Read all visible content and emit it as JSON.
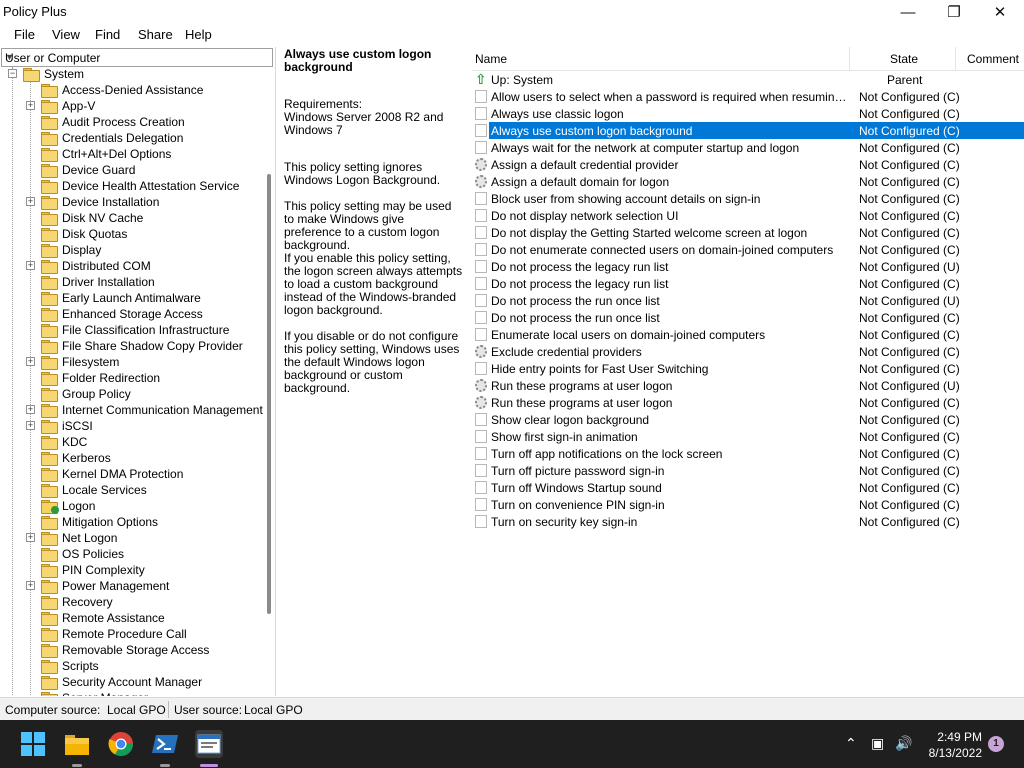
{
  "window": {
    "title": "Policy Plus"
  },
  "menu": [
    "File",
    "View",
    "Find",
    "Share",
    "Help"
  ],
  "tree": {
    "scope_label": "User or Computer",
    "root": "System",
    "items": [
      {
        "label": "Access-Denied Assistance",
        "expandable": false
      },
      {
        "label": "App-V",
        "expandable": true
      },
      {
        "label": "Audit Process Creation",
        "expandable": false
      },
      {
        "label": "Credentials Delegation",
        "expandable": false
      },
      {
        "label": "Ctrl+Alt+Del Options",
        "expandable": false
      },
      {
        "label": "Device Guard",
        "expandable": false
      },
      {
        "label": "Device Health Attestation Service",
        "expandable": false
      },
      {
        "label": "Device Installation",
        "expandable": true
      },
      {
        "label": "Disk NV Cache",
        "expandable": false
      },
      {
        "label": "Disk Quotas",
        "expandable": false
      },
      {
        "label": "Display",
        "expandable": false
      },
      {
        "label": "Distributed COM",
        "expandable": true
      },
      {
        "label": "Driver Installation",
        "expandable": false
      },
      {
        "label": "Early Launch Antimalware",
        "expandable": false
      },
      {
        "label": "Enhanced Storage Access",
        "expandable": false
      },
      {
        "label": "File Classification Infrastructure",
        "expandable": false
      },
      {
        "label": "File Share Shadow Copy Provider",
        "expandable": false
      },
      {
        "label": "Filesystem",
        "expandable": true
      },
      {
        "label": "Folder Redirection",
        "expandable": false
      },
      {
        "label": "Group Policy",
        "expandable": false
      },
      {
        "label": "Internet Communication Management",
        "expandable": true
      },
      {
        "label": "iSCSI",
        "expandable": true
      },
      {
        "label": "KDC",
        "expandable": false
      },
      {
        "label": "Kerberos",
        "expandable": false
      },
      {
        "label": "Kernel DMA Protection",
        "expandable": false
      },
      {
        "label": "Locale Services",
        "expandable": false
      },
      {
        "label": "Logon",
        "expandable": false,
        "selected": true
      },
      {
        "label": "Mitigation Options",
        "expandable": false
      },
      {
        "label": "Net Logon",
        "expandable": true
      },
      {
        "label": "OS Policies",
        "expandable": false
      },
      {
        "label": "PIN Complexity",
        "expandable": false
      },
      {
        "label": "Power Management",
        "expandable": true
      },
      {
        "label": "Recovery",
        "expandable": false
      },
      {
        "label": "Remote Assistance",
        "expandable": false
      },
      {
        "label": "Remote Procedure Call",
        "expandable": false
      },
      {
        "label": "Removable Storage Access",
        "expandable": false
      },
      {
        "label": "Scripts",
        "expandable": false
      },
      {
        "label": "Security Account Manager",
        "expandable": false
      },
      {
        "label": "Server Manager",
        "expandable": false
      }
    ]
  },
  "description": {
    "title": "Always use custom logon background",
    "requirements": "Requirements:\nWindows Server 2008 R2 and Windows 7",
    "paragraphs": [
      "This policy setting ignores Windows Logon Background.",
      "This policy setting may be used to make Windows give preference to a custom logon background.",
      "If you enable this policy setting, the logon screen always attempts to load a custom background instead of the Windows-branded logon background.",
      "If you disable or do not configure this policy setting, Windows uses the default Windows logon background or custom background."
    ]
  },
  "list": {
    "columns": [
      "Name",
      "State",
      "Comment"
    ],
    "parent": {
      "name": "Up: System",
      "state": "Parent"
    },
    "rows": [
      {
        "name": "Allow users to select when a password is required when resuming from connected standby",
        "state": "Not Configured (C)",
        "icon": "policy"
      },
      {
        "name": "Always use classic logon",
        "state": "Not Configured (C)",
        "icon": "policy"
      },
      {
        "name": "Always use custom logon background",
        "state": "Not Configured (C)",
        "icon": "policy",
        "selected": true
      },
      {
        "name": "Always wait for the network at computer startup and logon",
        "state": "Not Configured (C)",
        "icon": "policy"
      },
      {
        "name": "Assign a default credential provider",
        "state": "Not Configured (C)",
        "icon": "gear"
      },
      {
        "name": "Assign a default domain for logon",
        "state": "Not Configured (C)",
        "icon": "gear"
      },
      {
        "name": "Block user from showing account details on sign-in",
        "state": "Not Configured (C)",
        "icon": "policy"
      },
      {
        "name": "Do not display network selection UI",
        "state": "Not Configured (C)",
        "icon": "policy"
      },
      {
        "name": "Do not display the Getting Started welcome screen at logon",
        "state": "Not Configured (C)",
        "icon": "policy"
      },
      {
        "name": "Do not enumerate connected users on domain-joined computers",
        "state": "Not Configured (C)",
        "icon": "policy"
      },
      {
        "name": "Do not process the legacy run list",
        "state": "Not Configured (U)",
        "icon": "policy"
      },
      {
        "name": "Do not process the legacy run list",
        "state": "Not Configured (C)",
        "icon": "policy"
      },
      {
        "name": "Do not process the run once list",
        "state": "Not Configured (U)",
        "icon": "policy"
      },
      {
        "name": "Do not process the run once list",
        "state": "Not Configured (C)",
        "icon": "policy"
      },
      {
        "name": "Enumerate local users on domain-joined computers",
        "state": "Not Configured (C)",
        "icon": "policy"
      },
      {
        "name": "Exclude credential providers",
        "state": "Not Configured (C)",
        "icon": "gear"
      },
      {
        "name": "Hide entry points for Fast User Switching",
        "state": "Not Configured (C)",
        "icon": "policy"
      },
      {
        "name": "Run these programs at user logon",
        "state": "Not Configured (U)",
        "icon": "gear"
      },
      {
        "name": "Run these programs at user logon",
        "state": "Not Configured (C)",
        "icon": "gear"
      },
      {
        "name": "Show clear logon background",
        "state": "Not Configured (C)",
        "icon": "policy"
      },
      {
        "name": "Show first sign-in animation",
        "state": "Not Configured (C)",
        "icon": "policy"
      },
      {
        "name": "Turn off app notifications on the lock screen",
        "state": "Not Configured (C)",
        "icon": "policy"
      },
      {
        "name": "Turn off picture password sign-in",
        "state": "Not Configured (C)",
        "icon": "policy"
      },
      {
        "name": "Turn off Windows Startup sound",
        "state": "Not Configured (C)",
        "icon": "policy"
      },
      {
        "name": "Turn on convenience PIN sign-in",
        "state": "Not Configured (C)",
        "icon": "policy"
      },
      {
        "name": "Turn on security key sign-in",
        "state": "Not Configured (C)",
        "icon": "policy"
      }
    ]
  },
  "status": {
    "computer_label": "Computer source:",
    "computer_value": "Local GPO",
    "user_label": "User source:",
    "user_value": "Local GPO"
  },
  "taskbar": {
    "time": "2:49 PM",
    "date": "8/13/2022",
    "notification_count": "1",
    "icons": [
      "windows-start-icon",
      "file-explorer-icon",
      "chrome-icon",
      "powershell-icon",
      "policy-plus-icon"
    ]
  },
  "colors": {
    "selection": "#0078d7",
    "taskbar": "#1f1f1f"
  }
}
